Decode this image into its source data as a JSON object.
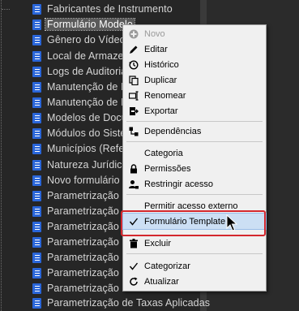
{
  "tree": {
    "items": [
      {
        "label": "Fabricantes de Instrumento"
      },
      {
        "label": "Formulário Modelo",
        "selected": true
      },
      {
        "label": "Gênero do Vídeo"
      },
      {
        "label": "Local de Armazenamento"
      },
      {
        "label": "Logs de Auditoria"
      },
      {
        "label": "Manutenção de Itens"
      },
      {
        "label": "Manutenção de Itens"
      },
      {
        "label": "Modelos de Documento"
      },
      {
        "label": "Módulos do Sistema"
      },
      {
        "label": "Municípios (Referência)"
      },
      {
        "label": "Natureza Jurídica"
      },
      {
        "label": "Novo formulário"
      },
      {
        "label": "Parametrização"
      },
      {
        "label": "Parametrização"
      },
      {
        "label": "Parametrização"
      },
      {
        "label": "Parametrização"
      },
      {
        "label": "Parametrização"
      },
      {
        "label": "Parametrização"
      },
      {
        "label": "Parametrização"
      },
      {
        "label": "Parametrização de Taxas Aplicadas"
      }
    ]
  },
  "menu": {
    "novo": "Novo",
    "editar": "Editar",
    "historico": "Histórico",
    "duplicar": "Duplicar",
    "renomear": "Renomear",
    "exportar": "Exportar",
    "dependencias": "Dependências",
    "categoria": "Categoria",
    "permissoes": "Permissões",
    "restringir": "Restringir acesso",
    "permitir_externo": "Permitir acesso externo",
    "formulario_template": "Formulário Template",
    "excluir": "Excluir",
    "categorizar": "Categorizar",
    "atualizar": "Atualizar"
  },
  "colors": {
    "tree_icon": "#2a66d9",
    "highlight_border": "#d4282e",
    "menu_hover": "#ccdff4"
  }
}
